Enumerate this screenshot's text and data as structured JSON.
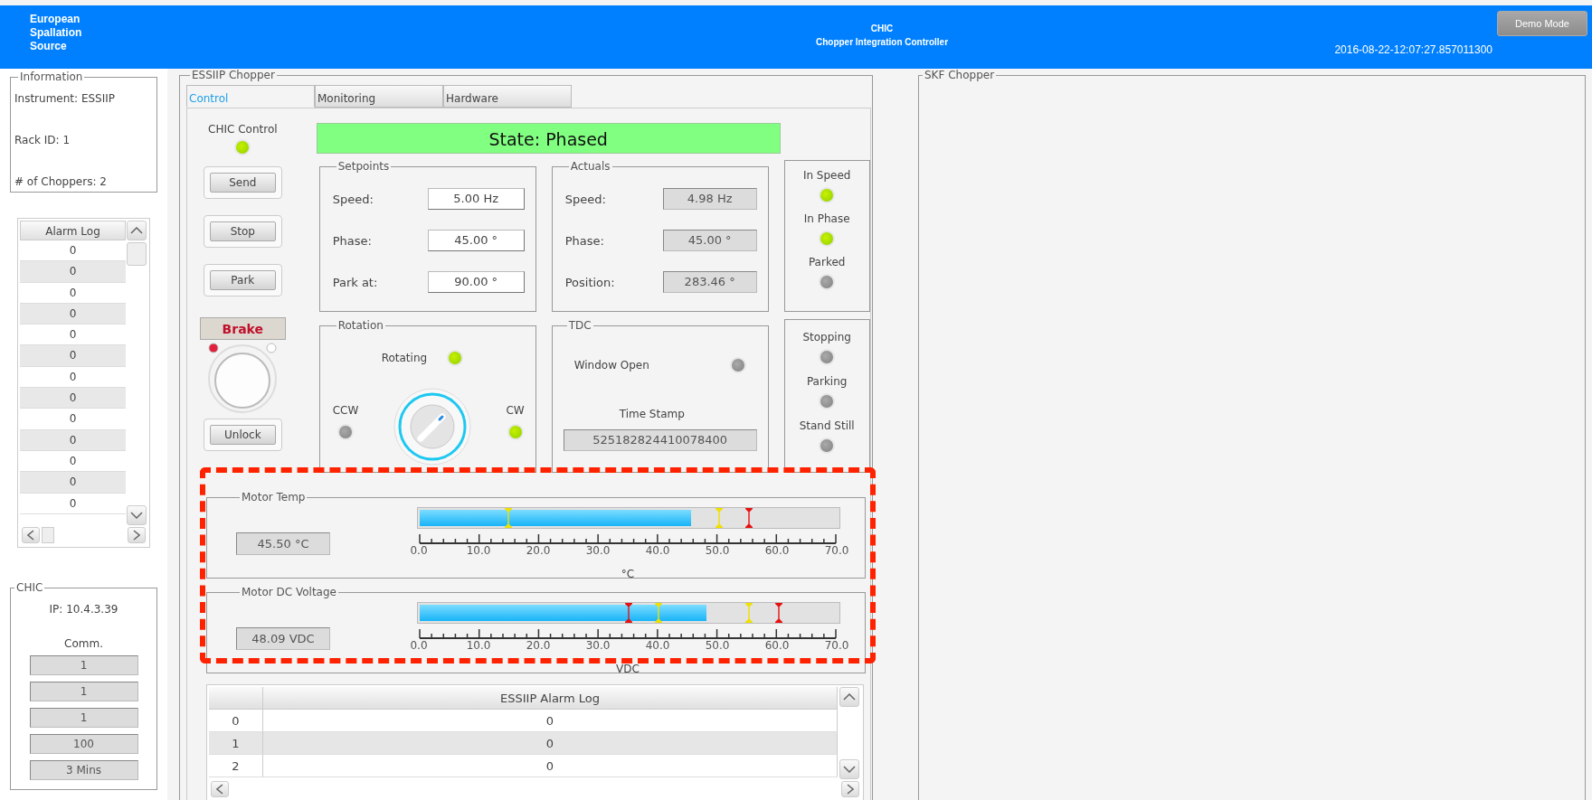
{
  "header": {
    "logo_lines": [
      "European",
      "Spallation",
      "Source"
    ],
    "title": "CHIC",
    "subtitle": "Chopper Integration Controller",
    "timestamp": "2016-08-22-12:07:27.857011300",
    "demo_button": {
      "label": "Demo Mode",
      "disabled": true
    }
  },
  "information": {
    "title": "Information",
    "lines": [
      "Instrument: ESSIIP",
      "Rack ID: 1",
      "# of Choppers: 2"
    ]
  },
  "alarm_log": {
    "header": "Alarm Log",
    "rows": [
      "0",
      "0",
      "0",
      "0",
      "0",
      "0",
      "0",
      "0",
      "0",
      "0",
      "0",
      "0",
      "0"
    ]
  },
  "chic": {
    "title": "CHIC",
    "ip": "IP: 10.4.3.39",
    "comm_label": "Comm.",
    "values": [
      "1",
      "1",
      "1",
      "100",
      "3 Mins"
    ]
  },
  "chopper": {
    "title": "ESSIIP Chopper",
    "tabs": [
      {
        "label": "Control",
        "selected": true
      },
      {
        "label": "Monitoring",
        "selected": false
      },
      {
        "label": "Hardware",
        "selected": false
      }
    ],
    "control": {
      "label": "CHIC Control",
      "on": true
    },
    "buttons": [
      "Send",
      "Stop",
      "Park"
    ],
    "brake": {
      "label": "Brake",
      "engaged": true
    },
    "unlock_button": "Unlock",
    "state": "State: Phased",
    "setpoints": {
      "title": "Setpoints",
      "rows": [
        {
          "label": "Speed:",
          "value": "5.00 Hz"
        },
        {
          "label": "Phase:",
          "value": "45.00 °"
        },
        {
          "label": "Park at:",
          "value": "90.00 °"
        }
      ]
    },
    "actuals": {
      "title": "Actuals",
      "rows": [
        {
          "label": "Speed:",
          "value": "4.98 Hz"
        },
        {
          "label": "Phase:",
          "value": "45.00 °"
        },
        {
          "label": "Position:",
          "value": "283.46 °"
        }
      ]
    },
    "status_upper": [
      {
        "label": "In Speed",
        "on": true
      },
      {
        "label": "In Phase",
        "on": true
      },
      {
        "label": "Parked",
        "on": false
      }
    ],
    "rotation": {
      "title": "Rotation",
      "rotating": {
        "label": "Rotating",
        "on": true
      },
      "ccw": {
        "label": "CCW",
        "on": false
      },
      "cw": {
        "label": "CW",
        "on": true
      }
    },
    "tdc": {
      "title": "TDC",
      "window_open": {
        "label": "Window Open",
        "on": false
      },
      "timestamp_label": "Time Stamp",
      "timestamp": "525182824410078400"
    },
    "status_lower": [
      {
        "label": "Stopping",
        "on": false
      },
      {
        "label": "Parking",
        "on": false
      },
      {
        "label": "Stand Still",
        "on": false
      }
    ],
    "gauges": [
      {
        "title": "Motor Temp",
        "reading": "45.50 °C",
        "level": 0.65,
        "unit": "°C",
        "ticks": [
          "0.0",
          "10.0",
          "20.0",
          "30.0",
          "40.0",
          "50.0",
          "60.0",
          "70.0"
        ],
        "markers": [
          {
            "color": "#f0e000",
            "level": 0.214
          },
          {
            "color": "#f0e000",
            "level": 0.714
          },
          {
            "color": "#e81010",
            "level": 0.786
          }
        ]
      },
      {
        "title": "Motor DC Voltage",
        "reading": "48.09 VDC",
        "level": 0.687,
        "unit": "VDC",
        "ticks": [
          "0.0",
          "10.0",
          "20.0",
          "30.0",
          "40.0",
          "50.0",
          "60.0",
          "70.0"
        ],
        "markers": [
          {
            "color": "#e81010",
            "level": 0.5
          },
          {
            "color": "#f0e000",
            "level": 0.571
          },
          {
            "color": "#f0e000",
            "level": 0.786
          },
          {
            "color": "#e81010",
            "level": 0.857
          }
        ]
      }
    ],
    "alarm_table": {
      "header": "ESSIIP Alarm Log",
      "rows": [
        {
          "index": "0",
          "value": "0"
        },
        {
          "index": "1",
          "value": "0"
        },
        {
          "index": "2",
          "value": "0"
        }
      ]
    }
  },
  "skf": {
    "title": "SKF Chopper"
  }
}
